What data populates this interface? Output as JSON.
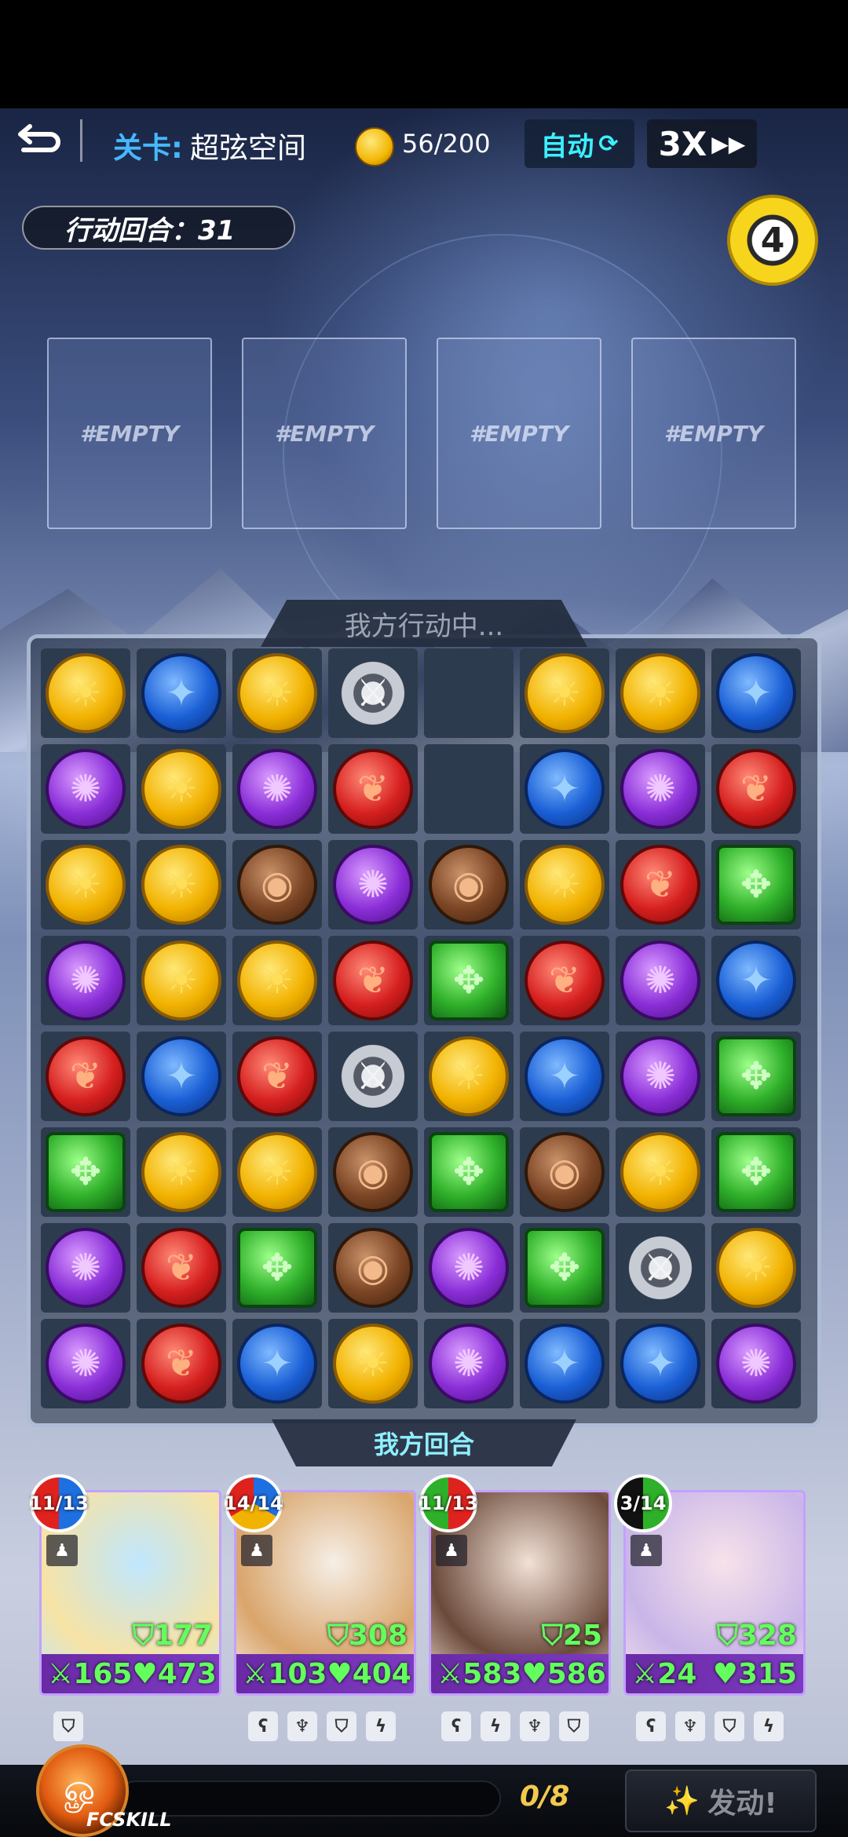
{
  "header": {
    "stage_label": "关卡:",
    "stage_name": "超弦空间",
    "coins": "56/200",
    "auto_label": "自动",
    "speed_label": "3X",
    "action_round": "行动回合：31",
    "round_counter": "4"
  },
  "slots": [
    "#EMPTY",
    "#EMPTY",
    "#EMPTY",
    "#EMPTY"
  ],
  "board": {
    "status_top": "我方行动中...",
    "status_bottom": "我方回合",
    "gem_symbols": {
      "sun": "☀",
      "water": "✦",
      "fire": "❦",
      "wind": "✺",
      "earth": "◉",
      "leaf": "✥",
      "sword": "⚔"
    },
    "grid": [
      [
        "sun",
        "water",
        "sun",
        "sword",
        "",
        "sun",
        "sun",
        "water"
      ],
      [
        "wind",
        "sun",
        "wind",
        "fire",
        "",
        "water",
        "wind",
        "fire"
      ],
      [
        "sun",
        "sun",
        "earth",
        "wind",
        "earth",
        "sun",
        "fire",
        "leaf"
      ],
      [
        "wind",
        "sun",
        "sun",
        "fire",
        "leaf",
        "fire",
        "wind",
        "water"
      ],
      [
        "fire",
        "water",
        "fire",
        "sword",
        "sun",
        "water",
        "wind",
        "leaf"
      ],
      [
        "leaf",
        "sun",
        "sun",
        "earth",
        "leaf",
        "earth",
        "sun",
        "leaf"
      ],
      [
        "wind",
        "fire",
        "leaf",
        "earth",
        "wind",
        "leaf",
        "sword",
        "sun"
      ],
      [
        "wind",
        "fire",
        "water",
        "sun",
        "wind",
        "water",
        "water",
        "wind"
      ]
    ]
  },
  "cards": [
    {
      "energy": "11/13",
      "defense": "177",
      "attack": "165",
      "hp": "473",
      "colors": [
        "#1e6fe0",
        "#e0221e"
      ],
      "art": [
        "#bfe7ff",
        "#f7e3a5"
      ]
    },
    {
      "energy": "14/14",
      "defense": "308",
      "attack": "103",
      "hp": "404",
      "colors": [
        "#1e6fe0",
        "#f2b200",
        "#e0221e"
      ],
      "art": [
        "#f6efe7",
        "#d9a56b"
      ]
    },
    {
      "energy": "11/13",
      "defense": "25",
      "attack": "583",
      "hp": "586",
      "colors": [
        "#e0221e",
        "#2fb02a"
      ],
      "art": [
        "#f2e1d6",
        "#6b4a3b"
      ]
    },
    {
      "energy": "3/14",
      "defense": "328",
      "attack": "24",
      "hp": "315",
      "colors": [
        "#2fb02a",
        "#111"
      ],
      "art": [
        "#f7e2ea",
        "#c9b6e8"
      ]
    }
  ],
  "footer": {
    "fc_label": "FCSKILL",
    "skill_progress": "0/8",
    "launch_label": "发动!"
  }
}
